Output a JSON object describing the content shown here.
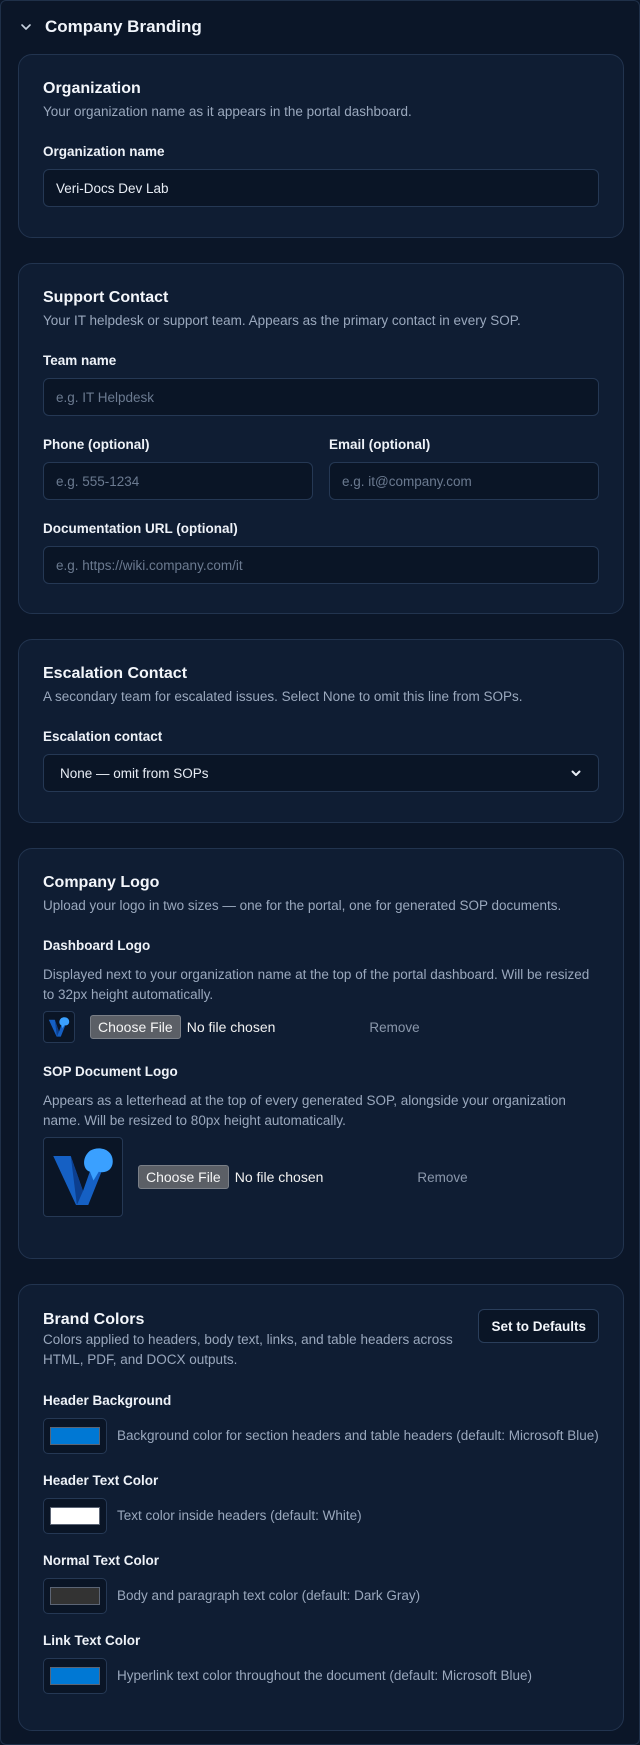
{
  "section": {
    "title": "Company Branding"
  },
  "organization": {
    "title": "Organization",
    "description": "Your organization name as it appears in the portal dashboard.",
    "name_label": "Organization name",
    "name_value": "Veri-Docs Dev Lab"
  },
  "support": {
    "title": "Support Contact",
    "description": "Your IT helpdesk or support team. Appears as the primary contact in every SOP.",
    "team_label": "Team name",
    "team_placeholder": "e.g. IT Helpdesk",
    "phone_label": "Phone (optional)",
    "phone_placeholder": "e.g. 555-1234",
    "email_label": "Email (optional)",
    "email_placeholder": "e.g. it@company.com",
    "url_label": "Documentation URL (optional)",
    "url_placeholder": "e.g. https://wiki.company.com/it"
  },
  "escalation": {
    "title": "Escalation Contact",
    "description": "A secondary team for escalated issues. Select None to omit this line from SOPs.",
    "contact_label": "Escalation contact",
    "selected": "None — omit from SOPs"
  },
  "logo": {
    "title": "Company Logo",
    "description": "Upload your logo in two sizes — one for the portal, one for generated SOP documents.",
    "dashboard": {
      "label": "Dashboard Logo",
      "description": "Displayed next to your organization name at the top of the portal dashboard. Will be resized to 32px height automatically.",
      "choose": "Choose File",
      "status": "No file chosen",
      "remove": "Remove"
    },
    "sop": {
      "label": "SOP Document Logo",
      "description": "Appears as a letterhead at the top of every generated SOP, alongside your organization name. Will be resized to 80px height automatically.",
      "choose": "Choose File",
      "status": "No file chosen",
      "remove": "Remove"
    }
  },
  "colors": {
    "title": "Brand Colors",
    "description": "Colors applied to headers, body text, links, and table headers across HTML, PDF, and DOCX outputs.",
    "defaults_button": "Set to Defaults",
    "items": [
      {
        "label": "Header Background",
        "description": "Background color for section headers and table headers (default: Microsoft Blue)",
        "color": "#0078d4"
      },
      {
        "label": "Header Text Color",
        "description": "Text color inside headers (default: White)",
        "color": "#ffffff"
      },
      {
        "label": "Normal Text Color",
        "description": "Body and paragraph text color (default: Dark Gray)",
        "color": "#333333"
      },
      {
        "label": "Link Text Color",
        "description": "Hyperlink text color throughout the document (default: Microsoft Blue)",
        "color": "#0078d4"
      }
    ]
  },
  "icons": {
    "collapse": "chevron-down-icon",
    "select_arrow": "chevron-down-icon",
    "logo": "veri-docs-logo"
  }
}
